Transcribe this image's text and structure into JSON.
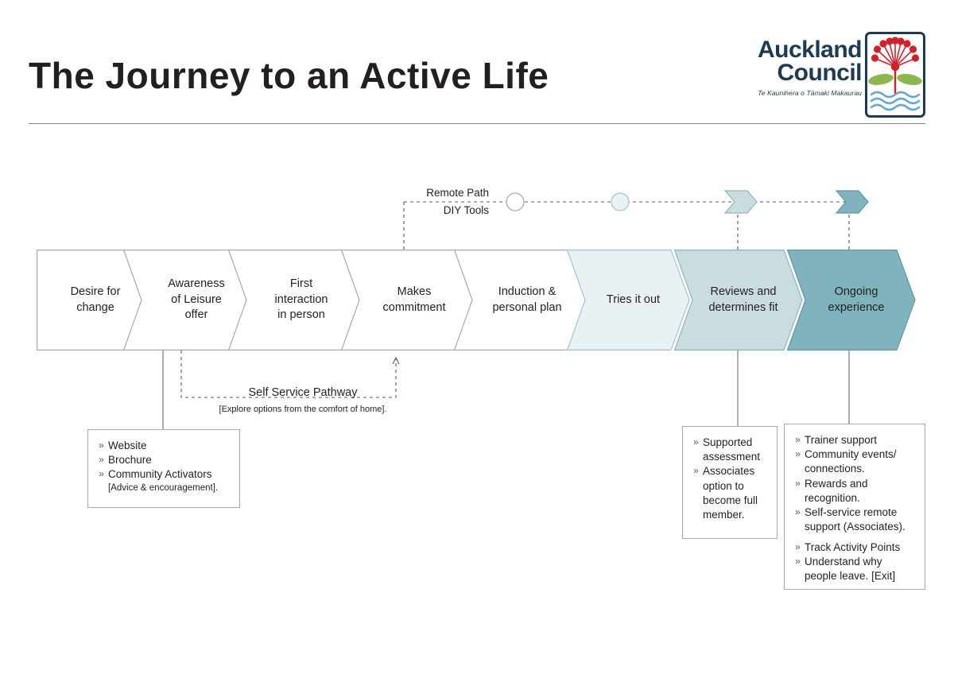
{
  "header": {
    "title": "The Journey to an Active Life"
  },
  "logo": {
    "line1": "Auckland",
    "line2": "Council",
    "maori": "Te Kaunihera o Tāmaki Makaurau",
    "icon": "pohutukawa-crest-icon",
    "navy": "#1b3a54",
    "red": "#d02128",
    "green": "#8cb84b",
    "blue": "#6aa5d4"
  },
  "flow": {
    "stages": [
      {
        "label_line1": "Desire for",
        "label_line2": "change",
        "fill": "#ffffff",
        "stroke": "#a7a9ac"
      },
      {
        "label_line1": "Awareness",
        "label_line2": "of Leisure",
        "label_line3": "offer",
        "fill": "#ffffff",
        "stroke": "#a7a9ac"
      },
      {
        "label_line1": "First",
        "label_line2": "interaction",
        "label_line3": "in person",
        "fill": "#ffffff",
        "stroke": "#a7a9ac"
      },
      {
        "label_line1": "Makes",
        "label_line2": "commitment",
        "fill": "#ffffff",
        "stroke": "#a7a9ac"
      },
      {
        "label_line1": "Induction &",
        "label_line2": "personal plan",
        "fill": "#ffffff",
        "stroke": "#a7a9ac"
      },
      {
        "label_line1": "Tries it out",
        "label_line2": "",
        "fill": "#e8f1f3",
        "stroke": "#a7c4cb"
      },
      {
        "label_line1": "Reviews and",
        "label_line2": "determines fit",
        "fill": "#c9dde1",
        "stroke": "#8fb6bf"
      },
      {
        "label_line1": "Ongoing",
        "label_line2": "experience",
        "fill": "#7fb3bd",
        "stroke": "#5f98a4"
      }
    ]
  },
  "remote_path": {
    "label_line1": "Remote Path",
    "label_line2": "DIY Tools",
    "nodes": [
      {
        "type": "circle",
        "name": "remote-node-circle-1",
        "fill": "#ffffff",
        "stroke": "#a7a9ac"
      },
      {
        "type": "circle",
        "name": "remote-node-circle-2",
        "fill": "#e8f1f3",
        "stroke": "#a7c4cb"
      },
      {
        "type": "chevron",
        "name": "remote-node-chevron-1",
        "fill": "#c9dde1",
        "stroke": "#8fb6bf"
      },
      {
        "type": "chevron",
        "name": "remote-node-chevron-2",
        "fill": "#7fb3bd",
        "stroke": "#5f98a4"
      }
    ]
  },
  "self_service": {
    "label": "Self Service Pathway",
    "sublabel": "[Explore options from the comfort of home]."
  },
  "callouts": {
    "awareness": {
      "items": [
        "Website",
        "Brochure",
        "Community Activators"
      ],
      "note": "[Advice & encouragement]."
    },
    "reviews": {
      "items": [
        "Supported assessment",
        "Associates option to become full member."
      ]
    },
    "ongoing": {
      "items": [
        "Trainer support",
        "Community events/ connections.",
        "Rewards and recognition.",
        "Self-service remote support (Associates).",
        "Track Activity Points",
        "Understand why people leave. [Exit]"
      ]
    }
  },
  "bullet_glyph": "»"
}
